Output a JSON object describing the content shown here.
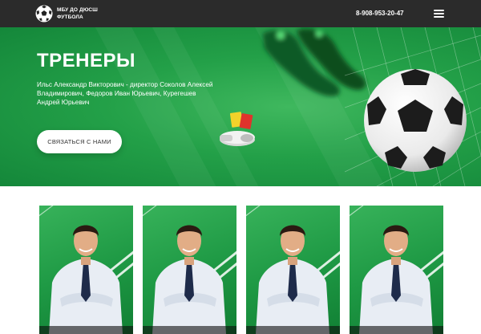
{
  "header": {
    "brand_line1": "МБУ ДО ДЮСШ",
    "brand_line2": "ФУТБОЛА",
    "phone": "8-908-953-20-47"
  },
  "hero": {
    "title": "ТРЕНЕРЫ",
    "description": "Ильс Александр Викторович - директор Соколов Алексей Владимирович, Федоров Иван Юрьевич, Курегешев Андрей Юрьевич",
    "contact_button": "СВЯЗАТЬСЯ С НАМИ"
  },
  "colors": {
    "header_bg": "#2b2b2b",
    "hero_green": "#23a048",
    "card_green": "#1f9a45",
    "button_bg": "#ffffff"
  },
  "icons": [
    "soccer-ball-logo-icon",
    "hamburger-menu-icon"
  ],
  "coaches": [
    {
      "photo": "coach-photo"
    },
    {
      "photo": "coach-photo"
    },
    {
      "photo": "coach-photo"
    },
    {
      "photo": "coach-photo"
    }
  ]
}
